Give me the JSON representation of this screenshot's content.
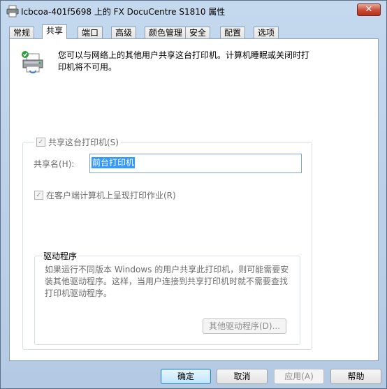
{
  "window": {
    "title": "Icbcoa-401f5698 上的 FX DocuCentre S1810 属性",
    "title_icon": "printer-icon",
    "close_icon": "close-icon",
    "close_glyph": "✕"
  },
  "tabs": [
    {
      "label": "常规",
      "active": false
    },
    {
      "label": "共享",
      "active": true
    },
    {
      "label": "端口",
      "active": false
    },
    {
      "label": "高级",
      "active": false
    },
    {
      "label": "颜色管理",
      "active": false
    },
    {
      "label": "安全",
      "active": false
    },
    {
      "label": "配置",
      "active": false
    },
    {
      "label": "选项",
      "active": false
    }
  ],
  "sharing": {
    "intro_line1": "您可以与网络上的其他用户共享这台打印机。计算机睡眠或关闭时打",
    "intro_line2": "印机将不可用。",
    "share_checkbox_label": "共享这台打印机(S)",
    "share_checked": true,
    "share_name_label": "共享名(H):",
    "share_name_value": "前台打印机",
    "render_jobs_label": "在客户端计算机上呈现打印作业(R)",
    "render_jobs_checked": true
  },
  "drivers": {
    "group_title": "驱动程序",
    "text_line1": "如果运行不同版本 Windows 的用户共享此打印机，则可能需要安",
    "text_line2": "装其他驱动程序。这样，当用户连接到共享打印机时就不需要查找",
    "text_line3": "打印机驱动程序。",
    "additional_drivers_button": "其他驱动程序(D)..."
  },
  "buttons": {
    "ok": "确定",
    "cancel": "取消",
    "apply": "应用(A)",
    "help": "帮助"
  },
  "check_glyph": "✓"
}
